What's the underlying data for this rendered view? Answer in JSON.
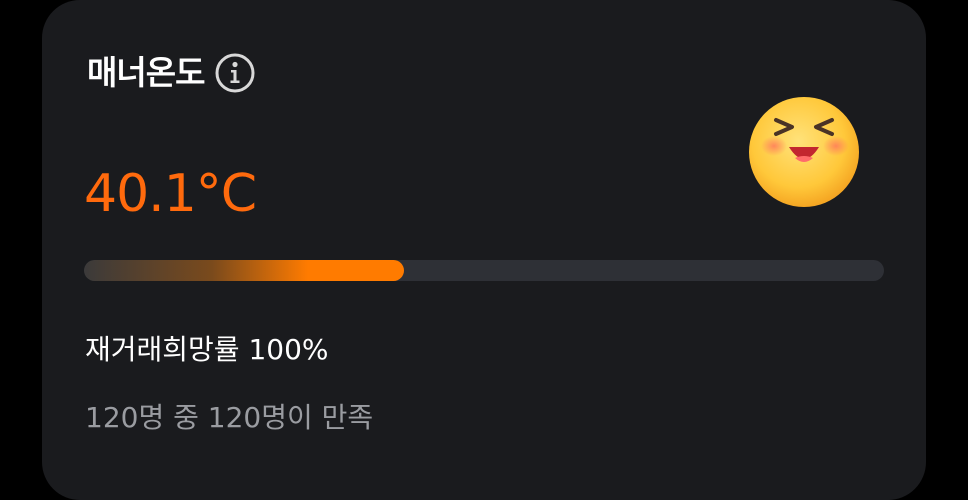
{
  "manner": {
    "title": "매너온도",
    "temperature": "40.1°C",
    "temperature_color": "#ff6a0d",
    "progress_fraction": 0.4,
    "emoji_icon": "grinning-squinting-face-icon",
    "rehire_rate": "재거래희망률 100%",
    "satisfaction": "120명 중 120명이 만족"
  }
}
